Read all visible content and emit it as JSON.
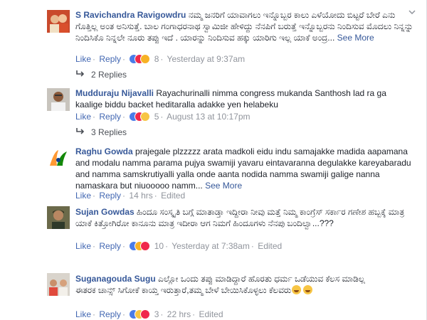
{
  "actions": {
    "like": "Like",
    "reply": "Reply",
    "separator": "·"
  },
  "comments": [
    {
      "author": "S Ravichandra Ravigowdru",
      "text": "ನಮ್ಮ ಜನರಿಗೆ ಯಾವಾಗಲು ಇನ್ನೊಬ್ಬರ ಕಾಲು ಎಳೆಯೋದು ಬಿಟ್ಟರೆ ಬೇರೆ ಎನು ಗೊತ್ತಿಲ್ಲ ಅಂತ ಅನಿಸುತ್ತೆ. ಬಾಲ ಗಂಗಾಧರನಾಥ ಸ್ವಾಮಿಜೀ ಹೇಳಿದ್ದು ನೆನಪಿಗೆ ಬರುತ್ತೆ ಇನ್ನೊಬ್ಬರನು ನಿಂದಿಸುವ ಮೊದಲು ನಿನ್ನನ್ನು ನಿಂದಿಸಿಕೊ ನಿನ್ನಲೇ ನೂರು ತಪ್ಪು ಇದೆ . ಯಾರನ್ನು ನಿಂದಿಸುವ ಹಕ್ಕು ಯಾರಿಗು ಇಲ್ಲ ಯಾಕೆ ಅಂದ್ರ...",
      "see_more": "See More",
      "reaction_count": "8",
      "time": "Yesterday at 9:37am",
      "edited": "",
      "replies": "2 Replies"
    },
    {
      "author": "Mudduraju Nijavalli",
      "text": "Rayachurinalli nimma congress mukanda Santhosh lad ra ga kaalige biddu backet heditaralla adakke yen helabeku",
      "see_more": "",
      "reaction_count": "5",
      "time": "August 13 at 10:17pm",
      "edited": "",
      "replies": "3 Replies"
    },
    {
      "author": "Raghu Gowda",
      "text": "prajegale plzzzzz arata madkoli eidu indu samajakke madida aapamana and modalu namma parama pujya swamiji yavaru eintavaranna degulakke kareyabaradu and namma samskrutiyalli yalla onde aanta nodida namma swamiji galige nanna namaskara but niuooooo namm...",
      "see_more": "See More",
      "reaction_count": "",
      "time": "14 hrs",
      "edited": "Edited",
      "replies": ""
    },
    {
      "author": "Sujan Gowdas",
      "text": "ಹಿಂದೂ ಸಂಸ್ಕೃತಿ ಬಗ್ಗೆ ಮಾತಾಡ್ತಾ ಇದ್ದೀರಾ ನೀವು ಮತ್ತೆ ನಿಮ್ಮ ಕಾಂಗ್ರೆಸ್ ಸರ್ಕಾರ ಗಣೇಶ ಹಬ್ಬಕ್ಕೆ ಮಾತ್ರ ಯಾಕೆ ಕಿತ್ತೋಗಿರೋ ಕಾನೂನು ಮಾತ್ರ ಇದೀರಾ ಆಗ ನಿಮಗೆ ಹಿಂದೂಗಳು ನೆನಪು ಬಂದಿಲ್ವಾ...???",
      "see_more": "",
      "reaction_count": "10",
      "time": "Yesterday at 7:38am",
      "edited": "Edited",
      "replies": ""
    },
    {
      "author": "Suganagouda Sugu",
      "text_line1": "ಎಲ್ಲೋ ಒಂದು ತಪ್ಪು ಮಾಡಿದ್ದಾರೆ ಹೊರತು ಧರ್ಮ ಒಡೆಯುವ ಕೆಲಸ ಮಾಡಿಲ್ಲ",
      "text_line2": "ಈತರಕ ಚಾನ್ಸ್ ಸಿಗೋಕೆ ಕಾಯ್ತ ಇರುತ್ತಾರೆ,ತಮ್ಮ ಬೇಳೆ ಬೇಯಿಸಿಕೊಳ್ಳಲು ಕೆಲವರು",
      "reaction_count": "3",
      "time": "22 hrs",
      "edited": "Edited",
      "replies": ""
    }
  ]
}
